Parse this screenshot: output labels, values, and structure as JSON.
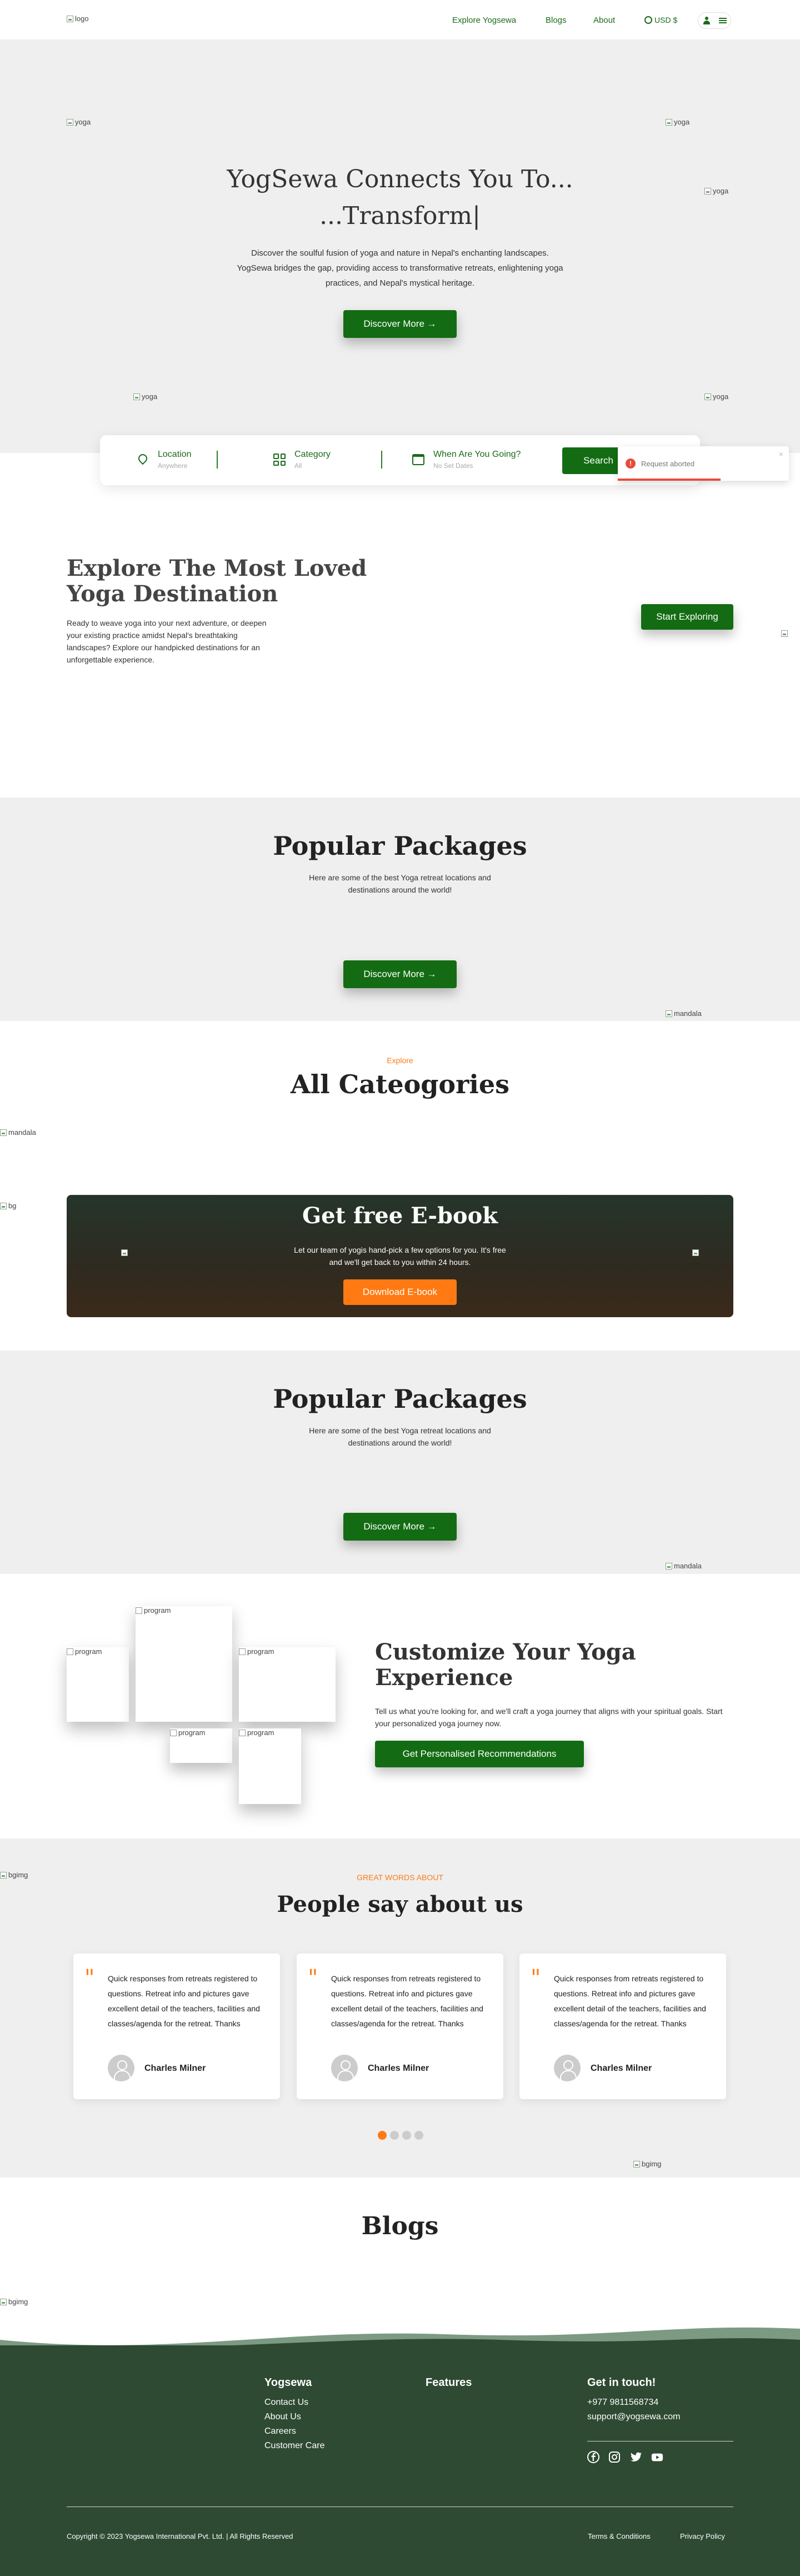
{
  "header": {
    "logo_alt": "logo",
    "nav": [
      "Explore Yogsewa",
      "Blogs",
      "About"
    ],
    "currency": "USD $"
  },
  "hero": {
    "title_line1": "YogSewa Connects You To...",
    "title_line2": "...Transform|",
    "description": "Discover the soulful fusion of yoga and nature in Nepal's enchanting landscapes. YogSewa bridges the gap, providing access to transformative retreats, enlightening yoga practices, and Nepal's mystical heritage.",
    "button": "Discover More →",
    "img_alt": "yoga"
  },
  "search": {
    "location_label": "Location",
    "location_value": "Anywhere",
    "category_label": "Category",
    "category_value": "All",
    "date_label": "When Are You Going?",
    "date_value": "No Set Dates",
    "button": "Search"
  },
  "toast": {
    "icon": "!",
    "message": "Request aborted",
    "close": "×"
  },
  "explore": {
    "title": "Explore The Most Loved Yoga Destination",
    "description": "Ready to weave yoga into your next adventure, or deepen your existing practice amidst Nepal's breathtaking landscapes? Explore our handpicked destinations for an unforgettable experience.",
    "button": "Start Exploring"
  },
  "packages": {
    "title": "Popular Packages",
    "subtitle": "Here are some of the best Yoga retreat locations and destinations around the world!",
    "button": "Discover More →",
    "img_alt": "mandala"
  },
  "categories": {
    "kicker": "Explore",
    "title": "All Cateogories",
    "img_alt": "mandala"
  },
  "ebook": {
    "bg_alt": "bg",
    "title": "Get free E-book",
    "description": "Let our team of yogis hand-pick a few options for you. It's free and we'll get back to you within 24 hours.",
    "button": "Download E-book"
  },
  "customize": {
    "img_alt": "program",
    "title": "Customize Your Yoga Experience",
    "description": "Tell us what you're looking for, and we'll craft a yoga journey that aligns with your spiritual goals. Start your personalized yoga journey now.",
    "button": "Get Personalised Recommendations"
  },
  "testimonials": {
    "bg_alt": "bgimg",
    "kicker": "GREAT WORDS ABOUT",
    "title": "People say about us",
    "items": [
      {
        "text": "Quick responses from retreats registered to questions. Retreat info and pictures gave excellent detail of the teachers, facilities and classes/agenda for the retreat. Thanks",
        "name": "Charles Milner"
      },
      {
        "text": "Quick responses from retreats registered to questions. Retreat info and pictures gave excellent detail of the teachers, facilities and classes/agenda for the retreat. Thanks",
        "name": "Charles Milner"
      },
      {
        "text": "Quick responses from retreats registered to questions. Retreat info and pictures gave excellent detail of the teachers, facilities and classes/agenda for the retreat. Thanks",
        "name": "Charles Milner"
      }
    ]
  },
  "blogs": {
    "title": "Blogs",
    "img_alt": "bgimg"
  },
  "footer": {
    "col1_title": "Yogsewa",
    "col1_links": [
      "Contact Us",
      "About Us",
      "Careers",
      "Customer Care"
    ],
    "col2_title": "Features",
    "col3_title": "Get in touch!",
    "phone": "+977 9811568734",
    "email": "support@yogsewa.com",
    "copyright": "Copyright © 2023 Yogsewa International Pvt. Ltd. | All Rights Reserved",
    "terms": "Terms & Conditions",
    "privacy": "Privacy Policy"
  },
  "colors": {
    "primary_green": "#136c13",
    "accent_orange": "#ff7a12",
    "footer_bg": "#2e4a32"
  }
}
